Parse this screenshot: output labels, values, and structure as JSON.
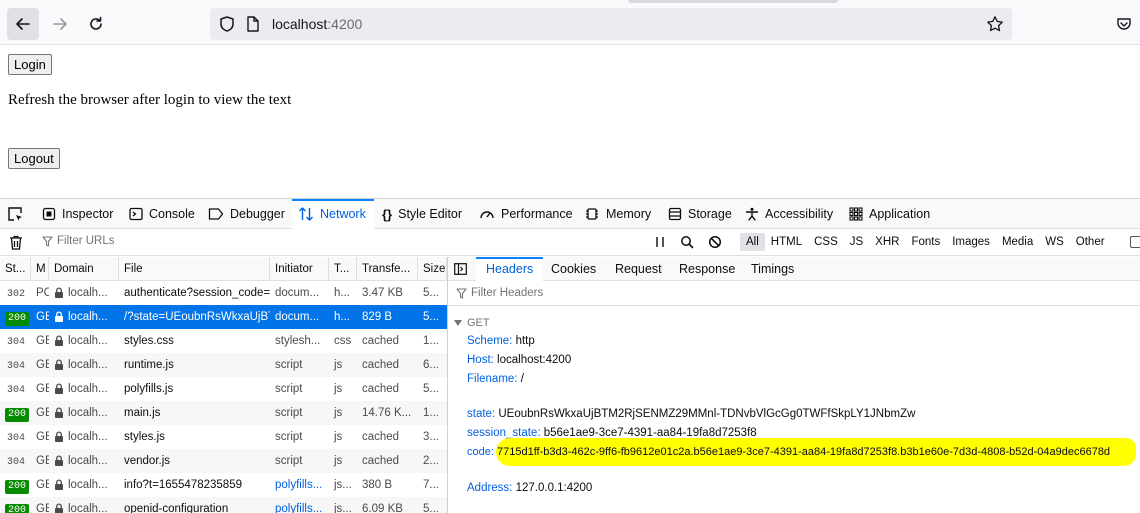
{
  "browser": {
    "url_host": "localhost",
    "url_port": ":4200"
  },
  "page": {
    "login_label": "Login",
    "message": "Refresh the browser after login to view the text",
    "logout_label": "Logout"
  },
  "devtools": {
    "tabs": [
      "Inspector",
      "Console",
      "Debugger",
      "Network",
      "Style Editor",
      "Performance",
      "Memory",
      "Storage",
      "Accessibility",
      "Application"
    ],
    "active_tab": "Network",
    "filter_placeholder": "Filter URLs",
    "type_filters": [
      "All",
      "HTML",
      "CSS",
      "JS",
      "XHR",
      "Fonts",
      "Images",
      "Media",
      "WS",
      "Other"
    ],
    "columns": [
      "St...",
      "M",
      "Domain",
      "File",
      "Initiator",
      "T...",
      "Transfe...",
      "Size"
    ],
    "requests": [
      {
        "status": "302",
        "method": "PC",
        "domain": "localh...",
        "file": "authenticate?session_code=",
        "initiator": "docum...",
        "type": "h...",
        "transfer": "3.47 KB",
        "size": "5..."
      },
      {
        "status": "200",
        "method": "GE",
        "domain": "localh...",
        "file": "/?state=UEoubnRsWkxaUjBT",
        "initiator": "docum...",
        "type": "h...",
        "transfer": "829 B",
        "size": "5..."
      },
      {
        "status": "304",
        "method": "GE",
        "domain": "localh...",
        "file": "styles.css",
        "initiator": "stylesh...",
        "type": "css",
        "transfer": "cached",
        "size": "1..."
      },
      {
        "status": "304",
        "method": "GE",
        "domain": "localh...",
        "file": "runtime.js",
        "initiator": "script",
        "type": "js",
        "transfer": "cached",
        "size": "6..."
      },
      {
        "status": "304",
        "method": "GE",
        "domain": "localh...",
        "file": "polyfills.js",
        "initiator": "script",
        "type": "js",
        "transfer": "cached",
        "size": "5..."
      },
      {
        "status": "200",
        "method": "GE",
        "domain": "localh...",
        "file": "main.js",
        "initiator": "script",
        "type": "js",
        "transfer": "14.76 K...",
        "size": "1..."
      },
      {
        "status": "304",
        "method": "GE",
        "domain": "localh...",
        "file": "styles.js",
        "initiator": "script",
        "type": "js",
        "transfer": "cached",
        "size": "3..."
      },
      {
        "status": "304",
        "method": "GE",
        "domain": "localh...",
        "file": "vendor.js",
        "initiator": "script",
        "type": "js",
        "transfer": "cached",
        "size": "2..."
      },
      {
        "status": "200",
        "method": "GE",
        "domain": "localh...",
        "file": "info?t=1655478235859",
        "initiator": "polyfills...",
        "type": "js...",
        "transfer": "380 B",
        "size": "7..."
      },
      {
        "status": "200",
        "method": "GE",
        "domain": "localh...",
        "file": "openid-configuration",
        "initiator": "polyfills...",
        "type": "js...",
        "transfer": "6.09 KB",
        "size": "5..."
      }
    ],
    "selected_row": 1,
    "panel_tabs": [
      "Headers",
      "Cookies",
      "Request",
      "Response",
      "Timings"
    ],
    "active_panel_tab": "Headers",
    "filter_headers_placeholder": "Filter Headers",
    "section": "GET",
    "fields": {
      "scheme_key": "Scheme:",
      "scheme": "http",
      "host_key": "Host:",
      "host": "localhost:4200",
      "filename_key": "Filename:",
      "filename": "/",
      "state_key": "state:",
      "state": "UEoubnRsWkxaUjBTM2RjSENMZ29MMnl-TDNvbVlGcGg0TWFfSkpLY1JNbmZw",
      "session_state_key": "session_state:",
      "session_state": "b56e1ae9-3ce7-4391-aa84-19fa8d7253f8",
      "code_key": "code:",
      "code": "7715d1ff-b3d3-462c-9ff6-fb9612e01c2a.b56e1ae9-3ce7-4391-aa84-19fa8d7253f8.b3b1e60e-7d3d-4808-b52d-04a9dec6678d",
      "address_key": "Address:",
      "address": "127.0.0.1:4200"
    }
  },
  "colors": {
    "accent": "#0a84ff",
    "selected_row": "#0074e8",
    "status_ok": "#058b00",
    "highlight": "#ffff00"
  }
}
